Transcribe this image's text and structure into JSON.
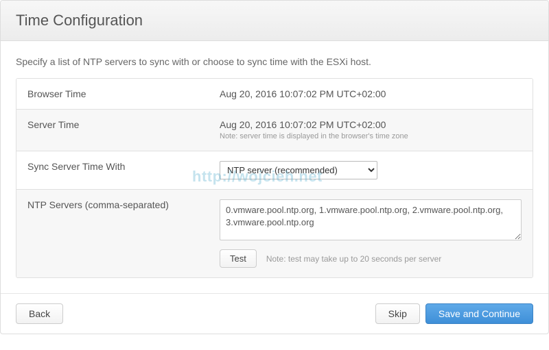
{
  "header": {
    "title": "Time Configuration"
  },
  "intro": "Specify a list of NTP servers to sync with or choose to sync time with the ESXi host.",
  "rows": {
    "browser_time": {
      "label": "Browser Time",
      "value": "Aug 20, 2016 10:07:02 PM UTC+02:00"
    },
    "server_time": {
      "label": "Server Time",
      "value": "Aug 20, 2016 10:07:02 PM UTC+02:00",
      "note": "Note: server time is displayed in the browser's time zone"
    },
    "sync_with": {
      "label": "Sync Server Time With",
      "selected": "NTP server (recommended)"
    },
    "ntp_servers": {
      "label": "NTP Servers (comma-separated)",
      "value": "0.vmware.pool.ntp.org, 1.vmware.pool.ntp.org, 2.vmware.pool.ntp.org, 3.vmware.pool.ntp.org",
      "test_label": "Test",
      "test_note": "Note: test may take up to 20 seconds per server"
    }
  },
  "footer": {
    "back": "Back",
    "skip": "Skip",
    "save": "Save and Continue"
  },
  "watermark": "http://wojcieh.net"
}
